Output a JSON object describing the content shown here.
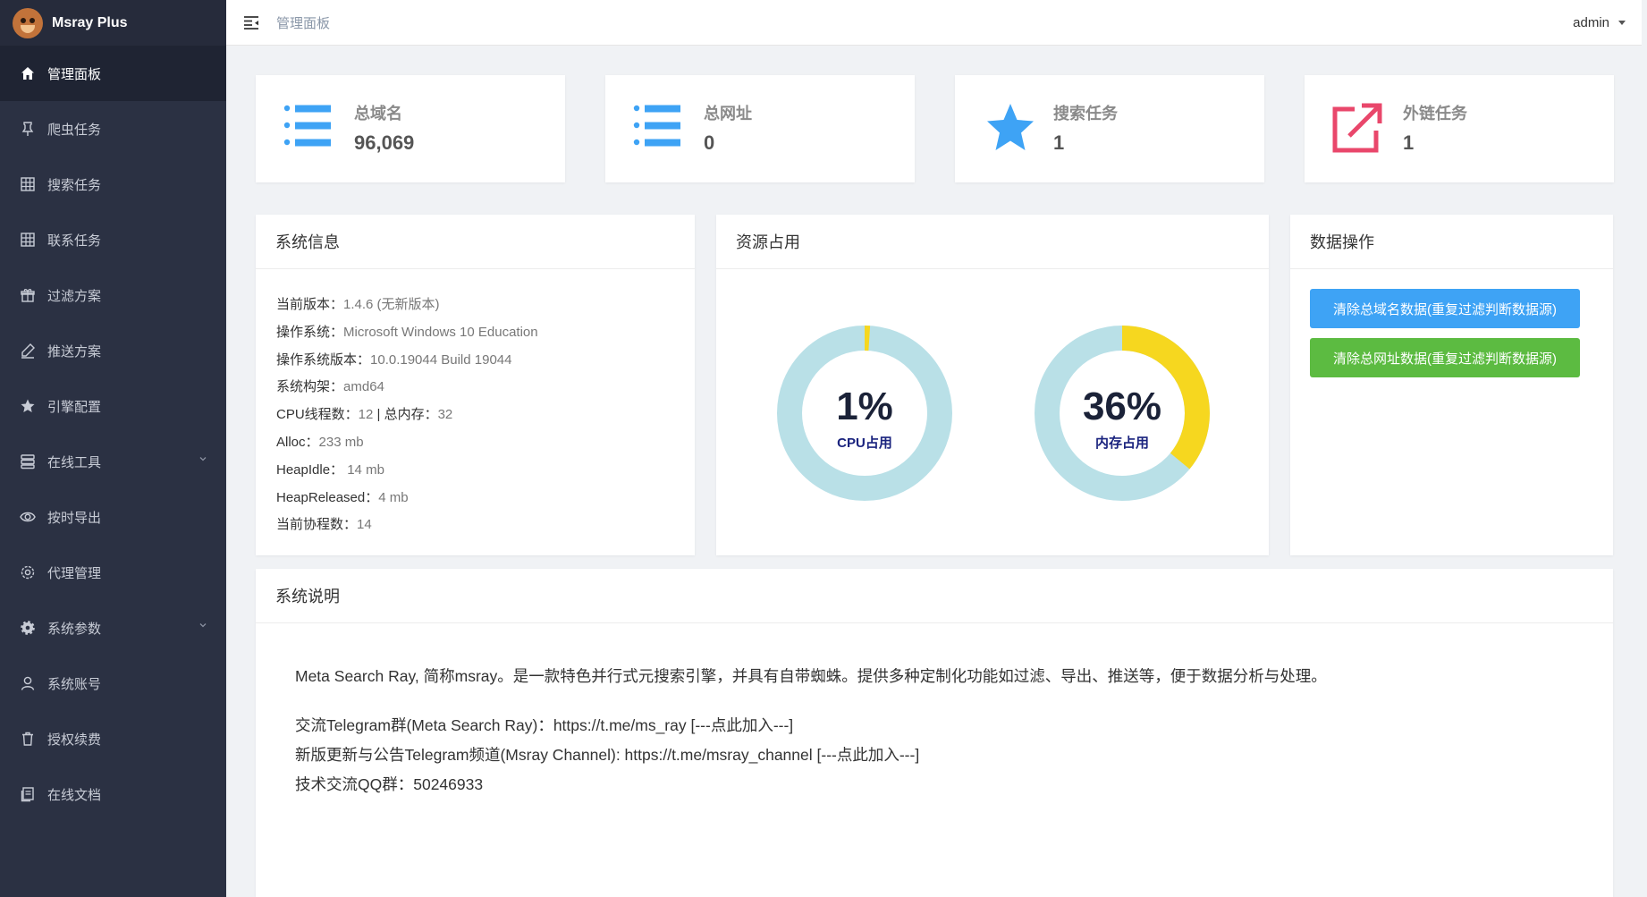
{
  "brand": {
    "name": "Msray Plus"
  },
  "sidebar": {
    "items": [
      {
        "label": "管理面板",
        "icon": "home-icon",
        "active": true
      },
      {
        "label": "爬虫任务",
        "icon": "pushpin-icon"
      },
      {
        "label": "搜索任务",
        "icon": "table-icon"
      },
      {
        "label": "联系任务",
        "icon": "table-icon"
      },
      {
        "label": "过滤方案",
        "icon": "gift-icon"
      },
      {
        "label": "推送方案",
        "icon": "pen-icon"
      },
      {
        "label": "引擎配置",
        "icon": "star-icon"
      },
      {
        "label": "在线工具",
        "icon": "stack-icon",
        "expandable": true
      },
      {
        "label": "按时导出",
        "icon": "eye-icon"
      },
      {
        "label": "代理管理",
        "icon": "settings-outline-icon"
      },
      {
        "label": "系统参数",
        "icon": "gear-icon",
        "expandable": true
      },
      {
        "label": "系统账号",
        "icon": "user-icon"
      },
      {
        "label": "授权续费",
        "icon": "trash-icon"
      },
      {
        "label": "在线文档",
        "icon": "document-icon"
      }
    ]
  },
  "header": {
    "breadcrumb": "管理面板",
    "user": "admin"
  },
  "stats": [
    {
      "label": "总域名",
      "value": "96,069",
      "icon": "list-icon",
      "color": "#3ea3f5"
    },
    {
      "label": "总网址",
      "value": "0",
      "icon": "list-icon",
      "color": "#3ea3f5"
    },
    {
      "label": "搜索任务",
      "value": "1",
      "icon": "star-icon",
      "color": "#3ea3f5"
    },
    {
      "label": "外链任务",
      "value": "1",
      "icon": "external-link-icon",
      "color": "#e9476b"
    }
  ],
  "sysinfo": {
    "title": "系统信息",
    "rows": [
      {
        "k": "当前版本：",
        "v": "1.4.6 (无新版本)"
      },
      {
        "k": "操作系统：",
        "v": "Microsoft Windows 10 Education"
      },
      {
        "k": "操作系统版本：",
        "v": "10.0.19044 Build 19044"
      },
      {
        "k": "系统构架：",
        "v": "amd64"
      },
      {
        "k": "CPU线程数：",
        "v": "12",
        "k2": " | 总内存：",
        "v2": "32"
      },
      {
        "k": "Alloc：",
        "v": "233 mb"
      },
      {
        "k": "HeapIdle： ",
        "v": "14 mb"
      },
      {
        "k": "HeapReleased：",
        "v": "4 mb"
      },
      {
        "k": "当前协程数：",
        "v": "14"
      }
    ]
  },
  "resources": {
    "title": "资源占用",
    "cpu": {
      "percent": 1,
      "text": "1%",
      "label": "CPU占用"
    },
    "mem": {
      "percent": 36,
      "text": "36%",
      "label": "内存占用"
    },
    "colors": {
      "track": "#b9e0e7",
      "fill": "#f6d71f"
    }
  },
  "ops": {
    "title": "数据操作",
    "clear_domains": "清除总域名数据(重复过滤判断数据源)",
    "clear_urls": "清除总网址数据(重复过滤判断数据源)"
  },
  "description": {
    "title": "系统说明",
    "intro": "Meta Search Ray, 简称msray。是一款特色并行式元搜索引擎，并具有自带蜘蛛。提供多种定制化功能如过滤、导出、推送等，便于数据分析与处理。",
    "telegram_group": "交流Telegram群(Meta Search Ray)：https://t.me/ms_ray [---点此加入---]",
    "telegram_channel": "新版更新与公告Telegram频道(Msray Channel): https://t.me/msray_channel [---点此加入---]",
    "qq_group": "技术交流QQ群：50246933"
  }
}
